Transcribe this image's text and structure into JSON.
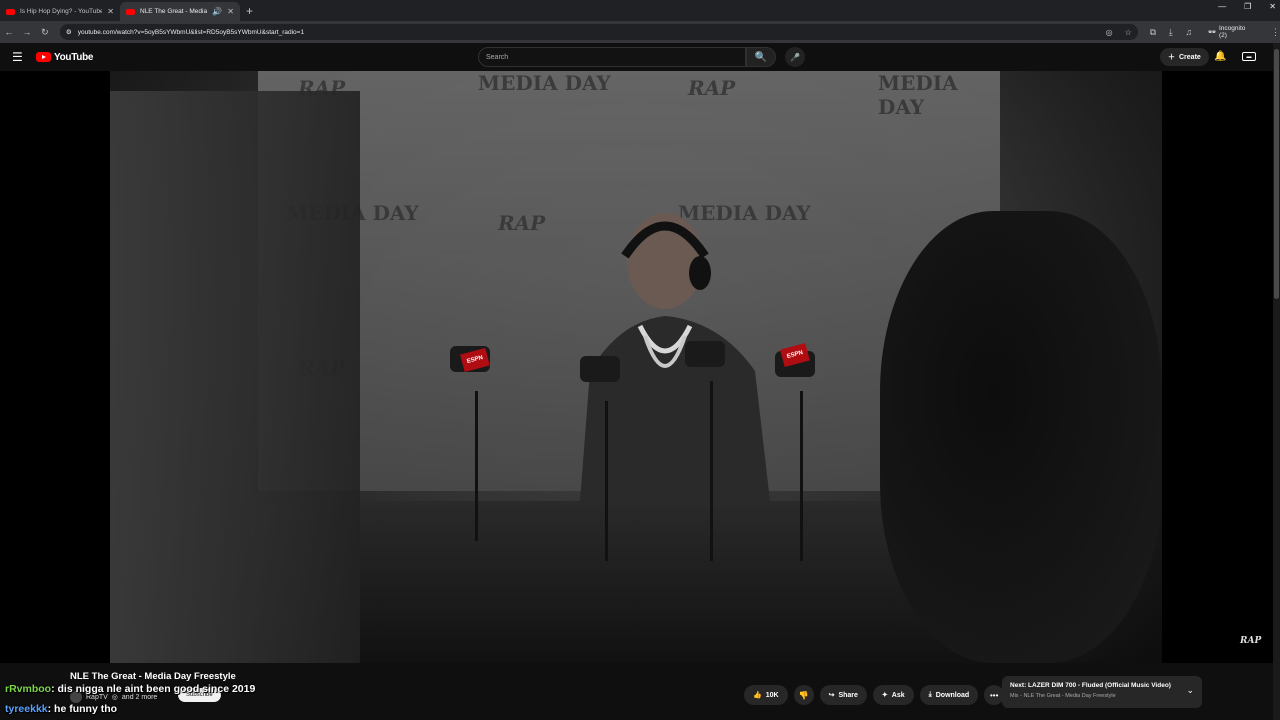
{
  "browser": {
    "tabs": [
      {
        "title": "Is Hip Hop Dying? - YouTube",
        "active": false
      },
      {
        "title": "NLE The Great - Media Da...",
        "active": true
      }
    ],
    "new_tab": "+",
    "url": "youtube.com/watch?v=5oyB5sYWbmU&list=RD5oyB5sYWbmU&start_radio=1",
    "incognito_label": "Incognito (2)"
  },
  "youtube": {
    "logo_text": "YouTube",
    "search_placeholder": "Search",
    "create_label": "Create"
  },
  "video": {
    "backdrop_text_1": "MEDIA DAY",
    "backdrop_text_2": "RAP",
    "watermark": "RAP",
    "title": "NLE The Great - Media Day Freestyle",
    "channel": "RapTV",
    "channel_suffix": "and 2 more",
    "subscribe_label": "Subscribe",
    "like_count": "10K",
    "share_label": "Share",
    "ask_label": "Ask",
    "download_label": "Download"
  },
  "next_up": {
    "title": "Next: LAZER DIM 700 - Fluded (Official Music Video)",
    "subtitle": "Mix - NLE The Great - Media Day Freestyle"
  },
  "chat": [
    {
      "user": "rRvmboo",
      "message": ": dis nigga nle aint been good since 2019"
    },
    {
      "user": "tyreekkk",
      "message": ": he funny tho"
    }
  ],
  "colors": {
    "brand_red": "#ff0000",
    "chat_user_green": "#7cd74a",
    "chat_user_blue": "#5aa2ff"
  }
}
